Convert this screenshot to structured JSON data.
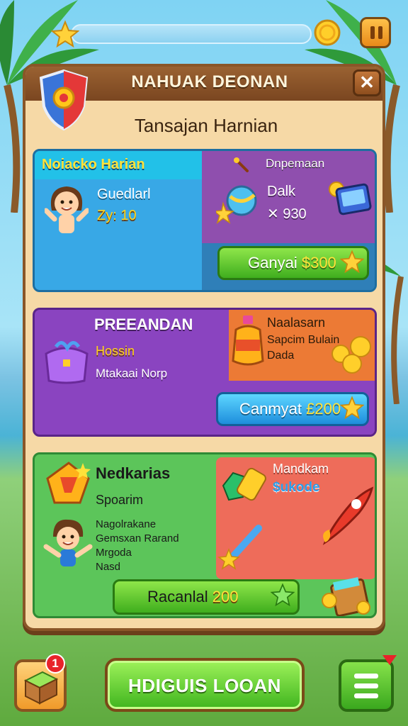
{
  "panel": {
    "title": "NAHUAK DEONAN",
    "subtitle": "Tansajan Harnian",
    "close_label": "✕"
  },
  "card1": {
    "header": "Noiacko Harian",
    "name": "Guedlarl",
    "level": "Zy: 10",
    "reward_title": "Dnpemaan",
    "item_name": "Dalk",
    "item_price": "✕ 930",
    "button_label": "Ganyai",
    "button_value": "$300"
  },
  "card2": {
    "title": "PREEANDAN",
    "subtitle": "Hossin",
    "desc": "Mtakaai Norp",
    "reward_title": "Naalasarn",
    "reward_line1": "Sapcim Bulain",
    "reward_line2": "Dada",
    "button_label": "Canmyat",
    "button_value": "£200"
  },
  "card3": {
    "title": "Nedkarias",
    "subtitle": "Spoarim",
    "desc1": "Nagolrakane",
    "desc2": "Gemsxan Rarand",
    "desc3": "Mrgoda",
    "desc4": "Nasd",
    "reward_title": "Mandkam",
    "reward_sub": "$ukode",
    "button_label": "Racanlal",
    "button_value": "200"
  },
  "bottom": {
    "badge_count": "1",
    "main_button": "HDIGUIS LOOAN"
  },
  "icons": [
    "star-icon",
    "coin-icon",
    "pause-icon",
    "shield-icon",
    "close-icon",
    "girl-avatar",
    "ball-icon",
    "tablet-icon",
    "gift-bag-icon",
    "jar-icon",
    "gem-icon",
    "boy-avatar",
    "rocket-icon",
    "chest-icon",
    "menu-icon"
  ],
  "colors": {
    "panel": "#f6d9a6",
    "panel_border": "#8a5628",
    "card1": "#38a8e6",
    "card2": "#8a44c0",
    "card3": "#5cc55a",
    "accent_yellow": "#ffd21a",
    "button_green": "#3fae1e"
  }
}
